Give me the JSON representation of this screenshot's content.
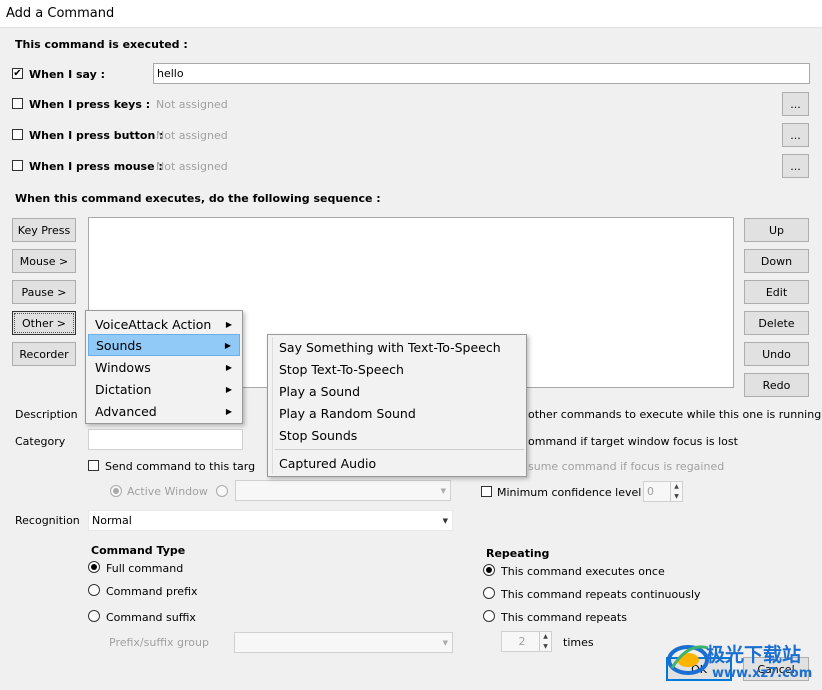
{
  "window": {
    "title": "Add a Command"
  },
  "executed_header": "This command is executed :",
  "triggers": {
    "when_i_say": {
      "label": "When I say :",
      "checked": true,
      "value": "hello"
    },
    "press_keys": {
      "label": "When I press keys :",
      "value": "Not assigned",
      "button": "..."
    },
    "press_button": {
      "label": "When I press button :",
      "value": "Not assigned",
      "button": "..."
    },
    "press_mouse": {
      "label": "When I press mouse :",
      "value": "Not assigned",
      "button": "..."
    }
  },
  "sequence_header": "When this command executes, do the following sequence :",
  "left_buttons": {
    "key_press": "Key Press",
    "mouse": "Mouse >",
    "pause": "Pause >",
    "other": "Other >",
    "recorder": "Recorder"
  },
  "right_buttons": {
    "up": "Up",
    "down": "Down",
    "edit": "Edit",
    "delete": "Delete",
    "undo": "Undo",
    "redo": "Redo"
  },
  "other_menu": {
    "items": [
      {
        "label": "VoiceAttack Action"
      },
      {
        "label": "Sounds"
      },
      {
        "label": "Windows"
      },
      {
        "label": "Dictation"
      },
      {
        "label": "Advanced"
      }
    ]
  },
  "sounds_submenu": {
    "items": [
      {
        "label": "Say Something with Text-To-Speech"
      },
      {
        "label": "Stop Text-To-Speech"
      },
      {
        "label": "Play a Sound"
      },
      {
        "label": "Play a Random Sound"
      },
      {
        "label": "Stop Sounds"
      },
      {
        "label": "Captured Audio"
      }
    ]
  },
  "description": {
    "label": "Description",
    "right_text": "other commands to execute while this one is running"
  },
  "category": {
    "label": "Category",
    "right_text": "ommand if target window focus is lost"
  },
  "send_command": {
    "label": "Send command to this targ",
    "right_text": "sume command if focus is regained"
  },
  "active_window": {
    "label": "Active Window"
  },
  "min_confidence": {
    "label": "Minimum confidence level",
    "value": "0"
  },
  "recognition": {
    "label": "Recognition",
    "value": "Normal"
  },
  "command_type": {
    "header": "Command Type",
    "options": [
      "Full command",
      "Command prefix",
      "Command suffix"
    ],
    "selected": "Full command",
    "prefix_group_label": "Prefix/suffix group"
  },
  "repeating": {
    "header": "Repeating",
    "options": [
      "This command executes once",
      "This command repeats continuously",
      "This command repeats"
    ],
    "selected": "This command executes once",
    "times_value": "2",
    "times_label": "times"
  },
  "footer": {
    "ok": "OK",
    "cancel": "Cancel"
  },
  "watermark": {
    "text": "极光下载站",
    "url": "www.xz7.com"
  },
  "colors": {
    "menu_highlight": "#91c9f7",
    "watermark_blue": "#1a6fd0"
  }
}
